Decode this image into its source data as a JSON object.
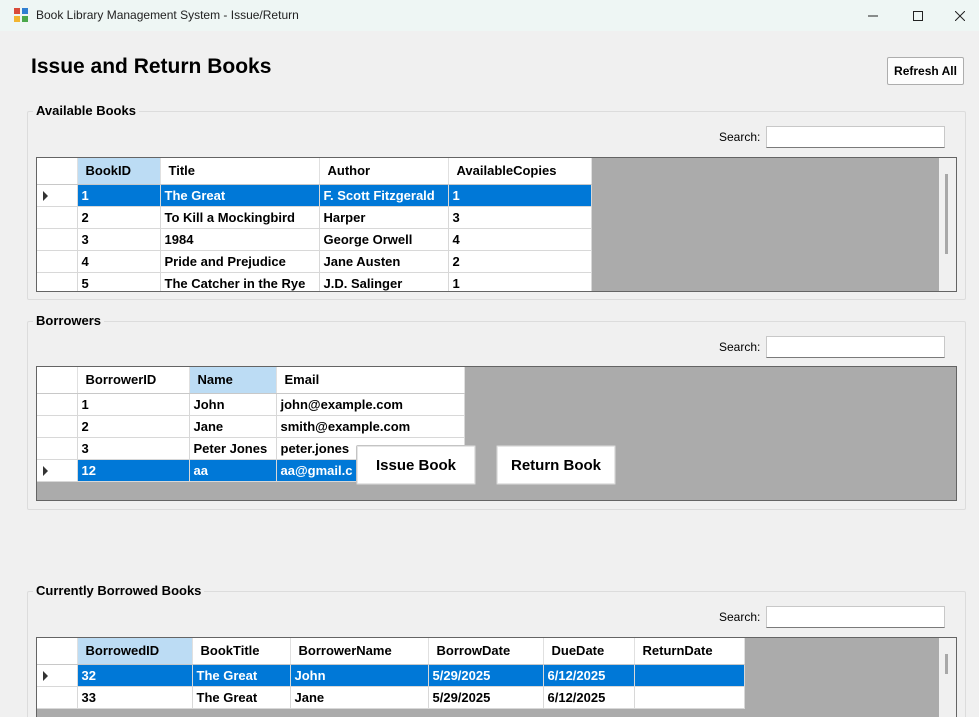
{
  "window": {
    "title": "Book Library Management System - Issue/Return"
  },
  "header": {
    "title": "Issue and Return Books",
    "refresh_label": "Refresh All"
  },
  "available_books": {
    "label": "Available Books",
    "search_label": "Search:",
    "columns": [
      "BookID",
      "Title",
      "Author",
      "AvailableCopies"
    ],
    "rows": [
      [
        "1",
        "The Great",
        "F. Scott Fitzgerald",
        "1"
      ],
      [
        "2",
        "To Kill a Mockingbird",
        "Harper",
        "3"
      ],
      [
        "3",
        "1984",
        "George Orwell",
        "4"
      ],
      [
        "4",
        "Pride and Prejudice",
        "Jane Austen",
        "2"
      ],
      [
        "5",
        "The Catcher in the Rye",
        "J.D. Salinger",
        "1"
      ]
    ]
  },
  "borrowers": {
    "label": "Borrowers",
    "search_label": "Search:",
    "columns": [
      "BorrowerID",
      "Name",
      "Email"
    ],
    "rows": [
      [
        "1",
        "John",
        "john@example.com"
      ],
      [
        "2",
        "Jane",
        "smith@example.com"
      ],
      [
        "3",
        "Peter Jones",
        "peter.jones"
      ],
      [
        "12",
        "aa",
        "aa@gmail.c"
      ]
    ]
  },
  "actions": {
    "issue_label": "Issue Book",
    "return_label": "Return Book"
  },
  "borrowed_books": {
    "label": "Currently Borrowed Books",
    "search_label": "Search:",
    "columns": [
      "BorrowedID",
      "BookTitle",
      "BorrowerName",
      "BorrowDate",
      "DueDate",
      "ReturnDate"
    ],
    "rows": [
      [
        "32",
        "The Great",
        "John",
        "5/29/2025",
        "6/12/2025",
        ""
      ],
      [
        "33",
        "The Great",
        "Jane",
        "5/29/2025",
        "6/12/2025",
        ""
      ]
    ]
  },
  "colors": {
    "selection": "#0078d7",
    "sorted_header": "#bcdcf4",
    "grid_background": "#ababab"
  }
}
